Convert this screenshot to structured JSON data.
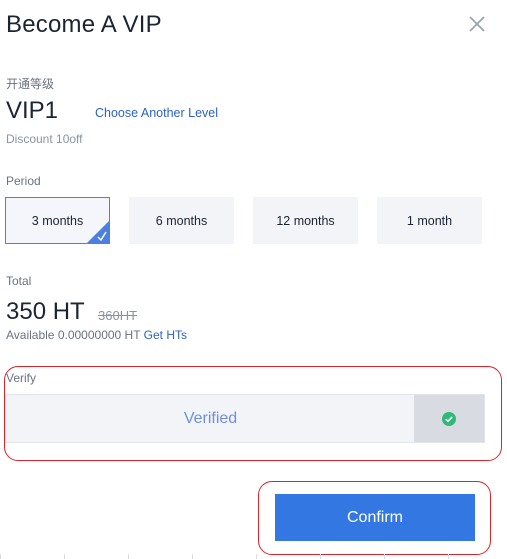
{
  "dialog": {
    "title": "Become A VIP"
  },
  "level": {
    "label": "开通等级",
    "name": "VIP1",
    "choose_link": "Choose Another Level",
    "discount": "Discount 10off"
  },
  "period": {
    "label": "Period",
    "options": [
      {
        "label": "3 months",
        "selected": true
      },
      {
        "label": "6 months",
        "selected": false
      },
      {
        "label": "12 months",
        "selected": false
      },
      {
        "label": "1 month",
        "selected": false
      }
    ]
  },
  "total": {
    "label": "Total",
    "price": "350 HT",
    "original_price": "360HT",
    "available_text": "Available 0.00000000 HT",
    "get_link": "Get HTs"
  },
  "verify": {
    "label": "Verify",
    "status_text": "Verified",
    "handle_icon": "check-circle-icon"
  },
  "confirm_label": "Confirm",
  "colors": {
    "accent": "#3277e2",
    "link": "#2b63c9",
    "verified_text": "#6f8fe0",
    "success": "#2fb877",
    "annotation": "#d9252b"
  }
}
